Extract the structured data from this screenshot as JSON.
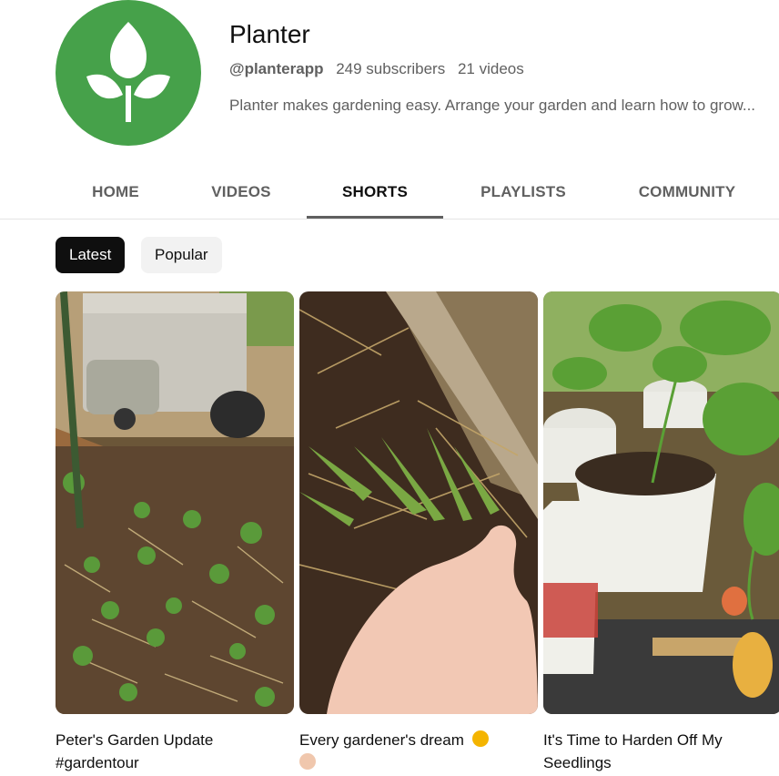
{
  "channel": {
    "name": "Planter",
    "handle": "@planterapp",
    "subscribers": "249 subscribers",
    "videos": "21 videos",
    "description": "Planter makes gardening easy. Arrange your garden and learn how to grow..."
  },
  "tabs": [
    "HOME",
    "VIDEOS",
    "SHORTS",
    "PLAYLISTS",
    "COMMUNITY"
  ],
  "active_tab": "SHORTS",
  "filters": [
    "Latest",
    "Popular"
  ],
  "selected_filter": "Latest",
  "shorts": [
    {
      "title": "Peter's Garden Update #gardentour"
    },
    {
      "title": "Every gardener's dream",
      "emoji": "star-struck-emoji",
      "emoji2": "folded-hands-emoji"
    },
    {
      "title": "It's Time to Harden Off My Seedlings"
    }
  ],
  "colors": {
    "brand": "#46a14a",
    "text": "#0f0f0f",
    "secondary": "#606060",
    "chip_bg": "#f2f2f2"
  }
}
